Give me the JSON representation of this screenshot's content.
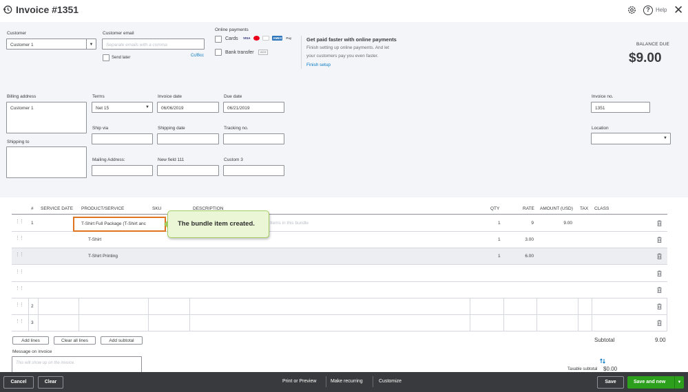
{
  "header": {
    "title": "Invoice #1351",
    "help_label": "Help",
    "close_glyph": "✕"
  },
  "customer": {
    "label": "Customer",
    "value": "Customer 1"
  },
  "email": {
    "label": "Customer email",
    "placeholder": "Separate emails with a comma",
    "send_later": "Send later",
    "cc_bcc": "Cc/Bcc"
  },
  "online_payments": {
    "label": "Online payments",
    "cards_label": "Cards",
    "bank_label": "Bank transfer",
    "card_logos": [
      "VISA",
      "MC",
      "AMEX",
      "Pay"
    ],
    "bank_logo": "ACH"
  },
  "promo": {
    "title": "Get paid faster with online payments",
    "line1": "Finish setting up online payments. And let",
    "line2": "your customers pay you even faster.",
    "link": "Finish setup"
  },
  "balance": {
    "label": "BALANCE DUE",
    "amount": "$9.00"
  },
  "billing": {
    "label": "Billing address",
    "value": "Customer 1",
    "shipping_label": "Shipping to"
  },
  "terms": {
    "label": "Terms",
    "value": "Net 15"
  },
  "invoice_date": {
    "label": "Invoice date",
    "value": "06/06/2019"
  },
  "due_date": {
    "label": "Due date",
    "value": "06/21/2019"
  },
  "invoice_no": {
    "label": "Invoice no.",
    "value": "1351"
  },
  "ship_via": {
    "label": "Ship via",
    "value": ""
  },
  "shipping_date": {
    "label": "Shipping date",
    "value": ""
  },
  "tracking_no": {
    "label": "Tracking no.",
    "value": ""
  },
  "location": {
    "label": "Location",
    "value": ""
  },
  "mailing_address": {
    "label": "Mailing Address:",
    "value": ""
  },
  "new_field": {
    "label": "New field 111",
    "value": ""
  },
  "custom3": {
    "label": "Custom 3",
    "value": ""
  },
  "table": {
    "columns": {
      "num": "#",
      "service_date": "SERVICE DATE",
      "product": "PRODUCT/SERVICE",
      "sku": "SKU",
      "description": "DESCRIPTION",
      "qty": "QTY",
      "rate": "RATE",
      "amount": "AMOUNT (USD)",
      "tax": "TAX",
      "class": "CLASS"
    },
    "rows": [
      {
        "num": "1",
        "product": "T-Shirt Full Package (T-Shirt anc",
        "description": "Items in this bundle",
        "qty": "1",
        "rate": "9",
        "amount": "9.00"
      },
      {
        "num": "",
        "product": "T-Shirt",
        "description": "",
        "qty": "1",
        "rate": "3.00",
        "amount": ""
      },
      {
        "num": "",
        "product": "T-Shirt Printing",
        "description": "",
        "qty": "1",
        "rate": "6.00",
        "amount": ""
      },
      {
        "num": "",
        "product": "",
        "description": "",
        "qty": "",
        "rate": "",
        "amount": ""
      },
      {
        "num": "",
        "product": "",
        "description": "",
        "qty": "",
        "rate": "",
        "amount": ""
      },
      {
        "num": "2",
        "product": "",
        "description": "",
        "qty": "",
        "rate": "",
        "amount": ""
      },
      {
        "num": "3",
        "product": "",
        "description": "",
        "qty": "",
        "rate": "",
        "amount": ""
      }
    ]
  },
  "callout": {
    "text": "The bundle item created."
  },
  "line_actions": {
    "add_lines": "Add lines",
    "clear_all": "Clear all lines",
    "add_subtotal": "Add subtotal"
  },
  "message": {
    "label": "Message on invoice",
    "placeholder": "This will show up on the invoice."
  },
  "totals": {
    "subtotal_label": "Subtotal",
    "subtotal_value": "9.00",
    "taxable_label": "Taxable subtotal",
    "taxable_value": "$0.00"
  },
  "footer": {
    "cancel": "Cancel",
    "clear": "Clear",
    "print_preview": "Print or Preview",
    "make_recurring": "Make recurring",
    "customize": "Customize",
    "save": "Save",
    "save_and_new": "Save and new"
  },
  "colors": {
    "accent_green": "#2ca01c",
    "link_blue": "#0077c5",
    "callout_border": "#e0731e",
    "footer_bg": "#393a3d"
  }
}
